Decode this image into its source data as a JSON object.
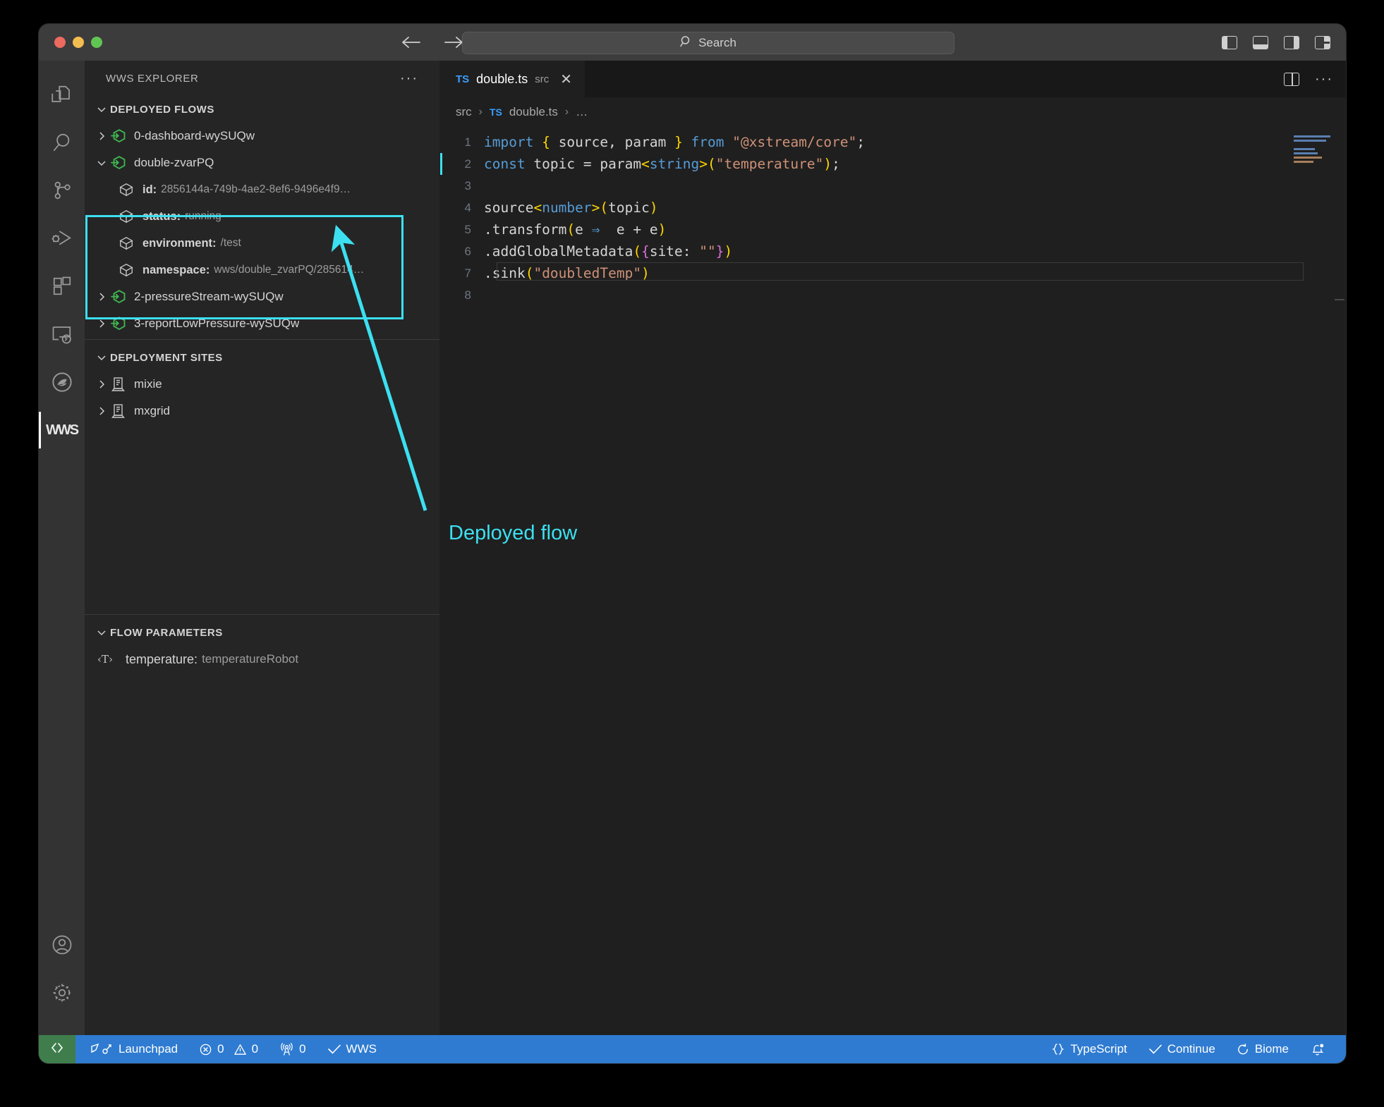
{
  "titlebar": {
    "search_placeholder": "Search",
    "back_icon": "arrow-left-icon",
    "forward_icon": "arrow-right-icon",
    "layout_icons": [
      "toggle-primary-sidebar-icon",
      "toggle-panel-icon",
      "toggle-secondary-sidebar-icon",
      "customize-layout-icon"
    ]
  },
  "activitybar": {
    "items": [
      {
        "name": "explorer",
        "icon": "files-icon"
      },
      {
        "name": "search",
        "icon": "search-icon"
      },
      {
        "name": "source-control",
        "icon": "source-control-icon"
      },
      {
        "name": "run-and-debug",
        "icon": "run-debug-icon"
      },
      {
        "name": "extensions",
        "icon": "extensions-icon"
      },
      {
        "name": "remote-explorer",
        "icon": "remote-explorer-icon"
      },
      {
        "name": "flink",
        "icon": "swirl-icon"
      },
      {
        "name": "wws",
        "icon": "wws-logo",
        "label": "WWS",
        "active": true
      }
    ],
    "bottom": [
      {
        "name": "accounts",
        "icon": "account-icon"
      },
      {
        "name": "settings",
        "icon": "gear-icon"
      }
    ]
  },
  "sidebar": {
    "title": "WWS EXPLORER",
    "more_actions": "···",
    "sections": [
      {
        "id": "deployed-flows",
        "label": "DEPLOYED FLOWS",
        "expanded": true,
        "items": [
          {
            "label": "0-dashboard-wySUQw",
            "expanded": false,
            "icon": "flow-icon"
          },
          {
            "label": "double-zvarPQ",
            "expanded": true,
            "icon": "flow-icon",
            "highlighted": true,
            "properties": [
              {
                "key": "id:",
                "value": "2856144a-749b-4ae2-8ef6-9496e4f9…",
                "icon": "package-icon"
              },
              {
                "key": "status:",
                "value": "running",
                "icon": "package-icon"
              },
              {
                "key": "environment:",
                "value": "/test",
                "icon": "package-icon"
              },
              {
                "key": "namespace:",
                "value": "wws/double_zvarPQ/285614…",
                "icon": "package-icon"
              }
            ]
          },
          {
            "label": "2-pressureStream-wySUQw",
            "expanded": false,
            "icon": "flow-icon"
          },
          {
            "label": "3-reportLowPressure-wySUQw",
            "expanded": false,
            "icon": "flow-icon"
          }
        ]
      },
      {
        "id": "deployment-sites",
        "label": "DEPLOYMENT SITES",
        "expanded": true,
        "items": [
          {
            "label": "mixie",
            "expanded": false,
            "icon": "server-icon"
          },
          {
            "label": "mxgrid",
            "expanded": false,
            "icon": "server-icon"
          }
        ]
      },
      {
        "id": "flow-parameters",
        "label": "FLOW PARAMETERS",
        "expanded": true,
        "items": [
          {
            "key": "temperature:",
            "value": "temperatureRobot",
            "icon": "string-type-icon",
            "icon_glyph": "‹T›"
          }
        ]
      }
    ]
  },
  "editor": {
    "tab": {
      "filetype": "TS",
      "filename": "double.ts",
      "description": "src",
      "close": "✕"
    },
    "tab_actions": [
      "split-editor-icon",
      "more-actions-icon"
    ],
    "breadcrumb": [
      "src",
      "TS",
      "double.ts",
      "…"
    ],
    "lines": [
      {
        "n": "1",
        "tokens": [
          {
            "t": "import",
            "c": "kw"
          },
          {
            "t": " ",
            "c": "plain"
          },
          {
            "t": "{",
            "c": "br"
          },
          {
            "t": " source, param ",
            "c": "plain"
          },
          {
            "t": "}",
            "c": "br"
          },
          {
            "t": " ",
            "c": "plain"
          },
          {
            "t": "from",
            "c": "kw"
          },
          {
            "t": " ",
            "c": "plain"
          },
          {
            "t": "\"@xstream/core\"",
            "c": "str"
          },
          {
            "t": ";",
            "c": "plain"
          }
        ]
      },
      {
        "n": "2",
        "tokens": [
          {
            "t": "const",
            "c": "kw"
          },
          {
            "t": " topic ",
            "c": "plain"
          },
          {
            "t": "=",
            "c": "plain"
          },
          {
            "t": " param",
            "c": "plain"
          },
          {
            "t": "<",
            "c": "br"
          },
          {
            "t": "string",
            "c": "kw"
          },
          {
            "t": ">",
            "c": "br"
          },
          {
            "t": "(",
            "c": "br"
          },
          {
            "t": "\"temperature\"",
            "c": "str"
          },
          {
            "t": ")",
            "c": "br"
          },
          {
            "t": ";",
            "c": "plain"
          }
        ]
      },
      {
        "n": "3",
        "tokens": []
      },
      {
        "n": "4",
        "tokens": [
          {
            "t": "source",
            "c": "plain"
          },
          {
            "t": "<",
            "c": "br"
          },
          {
            "t": "number",
            "c": "kw"
          },
          {
            "t": ">",
            "c": "br"
          },
          {
            "t": "(",
            "c": "br"
          },
          {
            "t": "topic",
            "c": "plain"
          },
          {
            "t": ")",
            "c": "br"
          }
        ]
      },
      {
        "n": "5",
        "tokens": [
          {
            "t": ".transform",
            "c": "plain"
          },
          {
            "t": "(",
            "c": "br"
          },
          {
            "t": "e ",
            "c": "plain"
          },
          {
            "t": "⇒",
            "c": "arrow"
          },
          {
            "t": "  e + e",
            "c": "plain"
          },
          {
            "t": ")",
            "c": "br"
          }
        ]
      },
      {
        "n": "6",
        "tokens": [
          {
            "t": ".addGlobalMetadata",
            "c": "plain"
          },
          {
            "t": "(",
            "c": "br"
          },
          {
            "t": "{",
            "c": "br2"
          },
          {
            "t": "site: ",
            "c": "plain"
          },
          {
            "t": "\"\"",
            "c": "str"
          },
          {
            "t": "}",
            "c": "br2"
          },
          {
            "t": ")",
            "c": "br"
          }
        ]
      },
      {
        "n": "7",
        "tokens": [
          {
            "t": ".sink",
            "c": "plain"
          },
          {
            "t": "(",
            "c": "br"
          },
          {
            "t": "\"doubledTemp\"",
            "c": "str"
          },
          {
            "t": ")",
            "c": "br"
          }
        ]
      },
      {
        "n": "8",
        "tokens": []
      }
    ]
  },
  "annotation": {
    "label": "Deployed flow",
    "color": "#3ce0f0"
  },
  "statusbar": {
    "remote_icon": "remote-window-icon",
    "left": [
      {
        "name": "launchpad",
        "label": "Launchpad",
        "icon": "rocket-icon"
      },
      {
        "name": "problems",
        "label": "0",
        "label2": "0",
        "icon": "error-warning-icon"
      },
      {
        "name": "radio-tower",
        "label": "0",
        "icon": "radio-tower-icon"
      },
      {
        "name": "wws-status",
        "label": "WWS",
        "icon": "check-icon"
      }
    ],
    "right": [
      {
        "name": "language-mode",
        "label": "TypeScript",
        "icon": "braces-icon"
      },
      {
        "name": "continue",
        "label": "Continue",
        "icon": "check-icon"
      },
      {
        "name": "biome",
        "label": "Biome",
        "icon": "refresh-icon"
      },
      {
        "name": "notifications",
        "label": "",
        "icon": "bell-dot-icon"
      }
    ]
  }
}
